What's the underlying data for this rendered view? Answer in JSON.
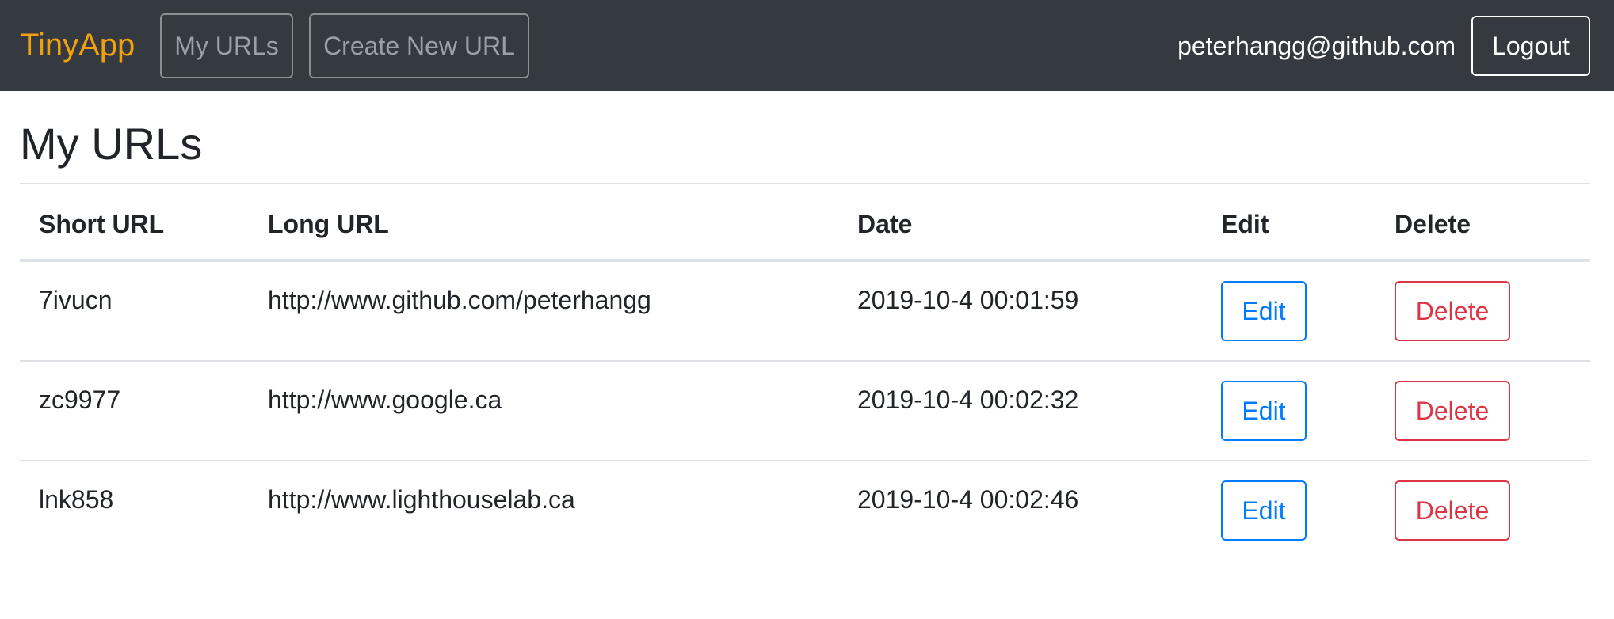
{
  "navbar": {
    "brand": "TinyApp",
    "links": [
      "My URLs",
      "Create New URL"
    ],
    "user_email": "peterhangg@github.com",
    "logout_label": "Logout"
  },
  "main": {
    "title": "My URLs",
    "table": {
      "headers": [
        "Short URL",
        "Long URL",
        "Date",
        "Edit",
        "Delete"
      ],
      "rows": [
        {
          "short_url": "7ivucn",
          "long_url": "http://www.github.com/peterhangg",
          "date": "2019-10-4 00:01:59",
          "edit_label": "Edit",
          "delete_label": "Delete"
        },
        {
          "short_url": "zc9977",
          "long_url": "http://www.google.ca",
          "date": "2019-10-4 00:02:32",
          "edit_label": "Edit",
          "delete_label": "Delete"
        },
        {
          "short_url": "lnk858",
          "long_url": "http://www.lighthouselab.ca",
          "date": "2019-10-4 00:02:46",
          "edit_label": "Edit",
          "delete_label": "Delete"
        }
      ]
    }
  },
  "colors": {
    "navbar_bg": "#343a40",
    "brand": "#f0a10c",
    "edit": "#007bff",
    "delete": "#dc3545",
    "text": "#212529"
  }
}
